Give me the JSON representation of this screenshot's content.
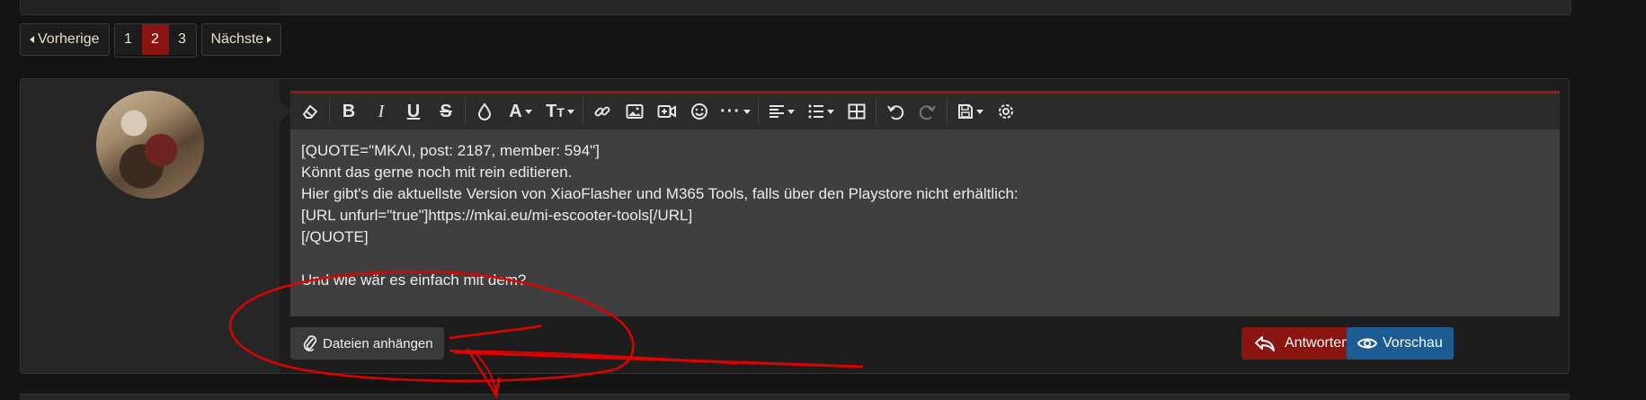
{
  "pagination": {
    "prev_label": "Vorherige",
    "next_label": "Nächste",
    "pages": [
      "1",
      "2",
      "3"
    ],
    "current_page": "2"
  },
  "toolbar": {
    "buttons": [
      "eraser-icon",
      "bold-icon",
      "italic-icon",
      "underline-icon",
      "strikethrough-icon",
      "text-color-icon",
      "font-family-icon",
      "font-size-icon",
      "link-icon",
      "image-icon",
      "media-icon",
      "smilie-icon",
      "more-icon",
      "align-icon",
      "list-icon",
      "table-icon",
      "undo-icon",
      "redo-icon",
      "drafts-icon",
      "settings-icon"
    ]
  },
  "editor": {
    "lines": [
      "[QUOTE=\"MKΛI, post: 2187, member: 594\"]",
      "Könnt das gerne noch mit rein editieren.",
      "Hier gibt's die aktuellste Version von XiaoFlasher und M365 Tools, falls über den Playstore nicht erhältlich:",
      "[URL unfurl=\"true\"]https://mkai.eu/mi-escooter-tools[/URL]",
      "[/QUOTE]",
      "",
      "Und wie wär es einfach mit dem?"
    ]
  },
  "actions": {
    "attach_label": "Dateien anhängen",
    "reply_label": "Antworten",
    "preview_label": "Vorschau"
  },
  "colors": {
    "accent_red": "#8a1410",
    "preview_blue": "#1d5c93",
    "annotation_red": "#e00000"
  }
}
